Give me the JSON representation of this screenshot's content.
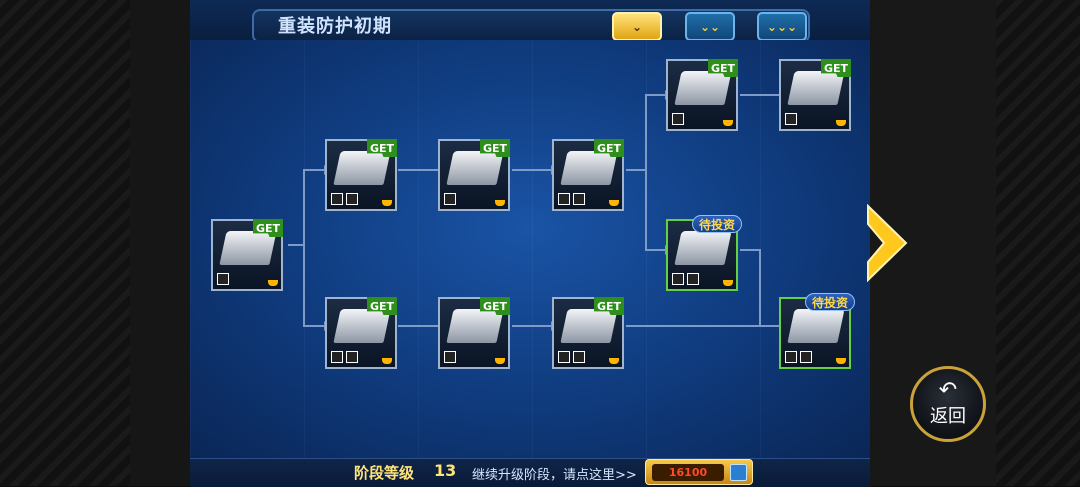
{
  "header": {
    "title": "重装防护初期",
    "tabs": [
      {
        "label": "⌄",
        "state": "active"
      },
      {
        "label": "⌄⌄",
        "state": "idle"
      },
      {
        "label": "⌄⌄⌄",
        "state": "idle"
      }
    ]
  },
  "tree": {
    "get_label": "GET",
    "invest_label": "待投资",
    "nodes": [
      {
        "id": "root",
        "status": "get"
      },
      {
        "id": "a1",
        "status": "get"
      },
      {
        "id": "a2",
        "status": "get"
      },
      {
        "id": "a3",
        "status": "get"
      },
      {
        "id": "a4",
        "status": "get"
      },
      {
        "id": "a5",
        "status": "get"
      },
      {
        "id": "b1",
        "status": "get"
      },
      {
        "id": "b2",
        "status": "get"
      },
      {
        "id": "b3",
        "status": "get"
      },
      {
        "id": "c1",
        "status": "pending"
      },
      {
        "id": "c2",
        "status": "pending"
      }
    ]
  },
  "footer": {
    "stage_label": "阶段等级",
    "stage_level": "13",
    "hint": "继续升级阶段，请点这里>>",
    "cost": "16100"
  },
  "back_button": {
    "label": "返回"
  },
  "colors": {
    "accent": "#ffe27a",
    "get_green": "#2f8f1c",
    "board_blue": "#0f3a7c"
  }
}
